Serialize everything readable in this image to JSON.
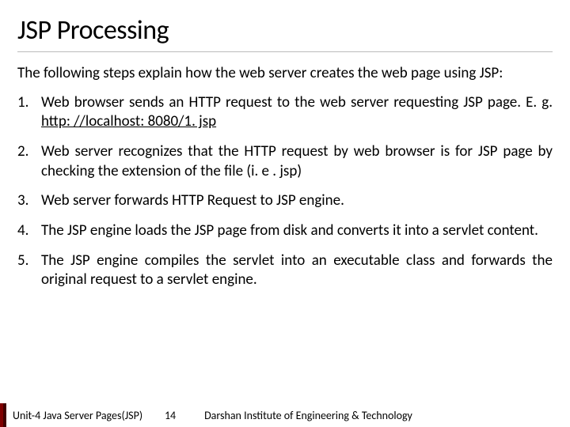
{
  "title": "JSP Processing",
  "intro": "The following steps explain how the web server creates the web page using JSP:",
  "items": [
    {
      "prefix": "Web browser sends an HTTP request to the web server requesting JSP page. E. g. ",
      "link": "http: //localhost: 8080/1. jsp",
      "suffix": ""
    },
    {
      "prefix": "Web server recognizes that the HTTP request by web browser is for JSP page by checking the extension of the file (i. e . jsp)",
      "link": "",
      "suffix": ""
    },
    {
      "prefix": "Web server forwards HTTP Request to JSP engine.",
      "link": "",
      "suffix": ""
    },
    {
      "prefix": "The JSP engine loads the JSP page from disk and converts it into a servlet content.",
      "link": "",
      "suffix": ""
    },
    {
      "prefix": "The JSP engine compiles the servlet into an executable class and forwards the original request to a servlet engine.",
      "link": "",
      "suffix": ""
    }
  ],
  "footer": {
    "unit": "Unit-4 Java Server Pages(JSP)",
    "page": "14",
    "institute": "Darshan Institute of Engineering & Technology"
  }
}
